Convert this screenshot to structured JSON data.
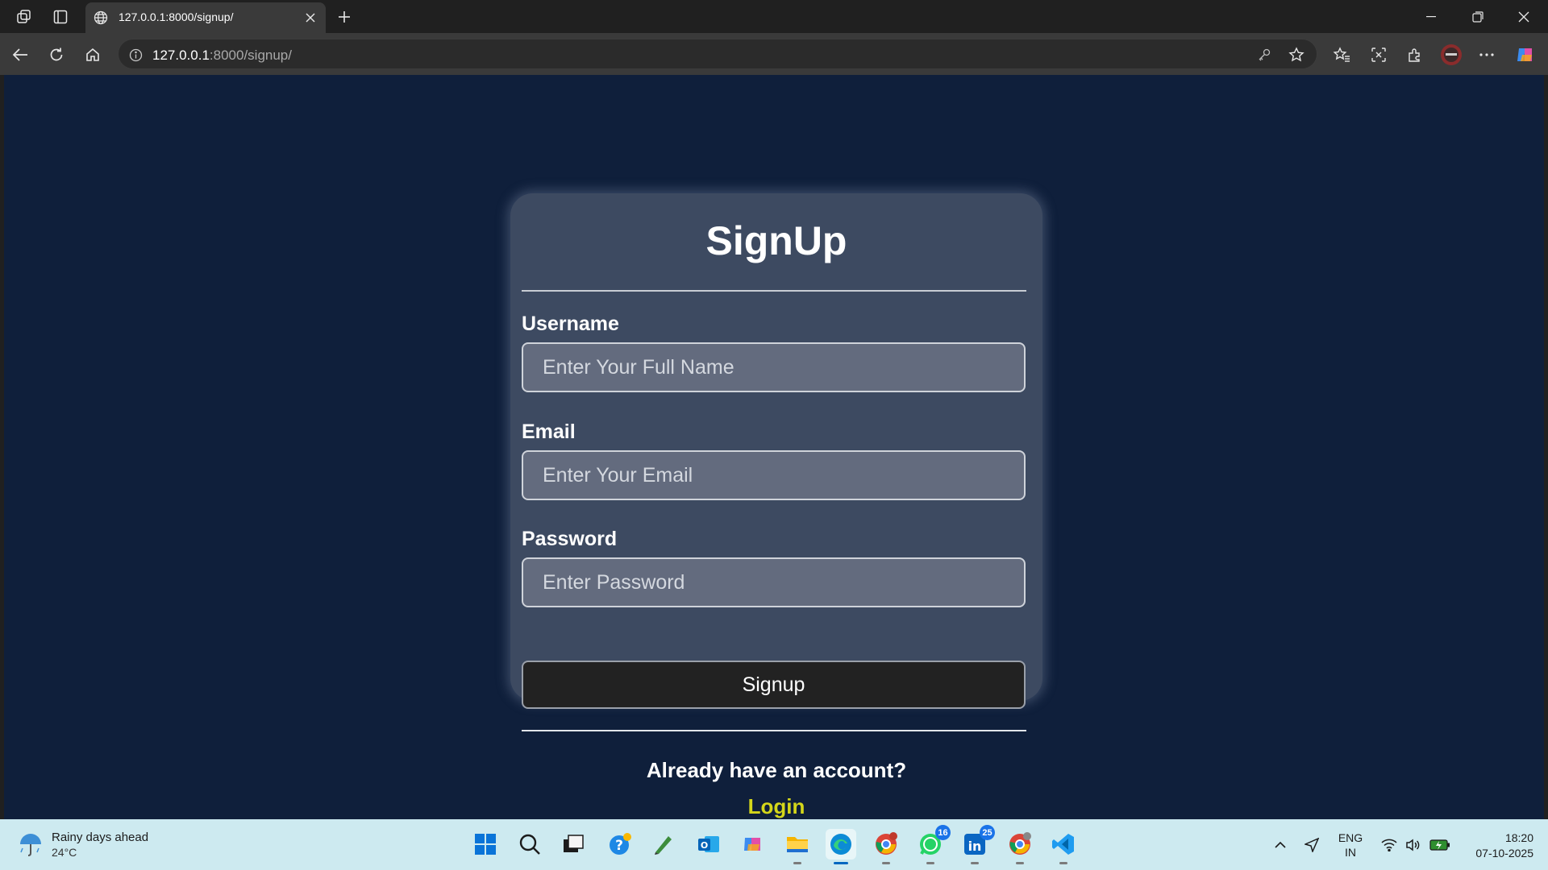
{
  "browser": {
    "tab_title": "127.0.0.1:8000/signup/",
    "url_host": "127.0.0.1",
    "url_path": ":8000/signup/",
    "icons": [
      "workspaces-icon",
      "tab-actions-icon",
      "globe-icon",
      "close-tab-icon",
      "new-tab-icon",
      "back-icon",
      "refresh-icon",
      "home-icon",
      "site-info-icon",
      "password-key-icon",
      "favorite-star-icon",
      "favorites-icon",
      "screenshot-icon",
      "extensions-icon",
      "profile-avatar",
      "more-icon",
      "copilot-icon"
    ]
  },
  "page": {
    "title": "SignUp",
    "username_label": "Username",
    "username_placeholder": "Enter Your Full Name",
    "email_label": "Email",
    "email_placeholder": "Enter Your Email",
    "password_label": "Password",
    "password_placeholder": "Enter Password",
    "submit_label": "Signup",
    "already_text": "Already have an account?",
    "login_label": "Login",
    "colors": {
      "background": "#0f1f3b",
      "card": "#3d4a61",
      "input": "#636b7e",
      "button": "#222222",
      "link": "#d4d61a"
    }
  },
  "taskbar": {
    "weather_text": "Rainy days ahead",
    "weather_temp": "24°C",
    "apps": [
      "windows-start",
      "search",
      "task-view",
      "copilot-app",
      "pen-app",
      "outlook",
      "copilot",
      "file-explorer",
      "edge",
      "chrome-profile",
      "whatsapp",
      "linkedin",
      "chrome",
      "vscode"
    ],
    "whatsapp_badge": "16",
    "linkedin_badge": "25",
    "lang_line1": "ENG",
    "lang_line2": "IN",
    "time": "18:20",
    "date": "07-10-2025"
  }
}
